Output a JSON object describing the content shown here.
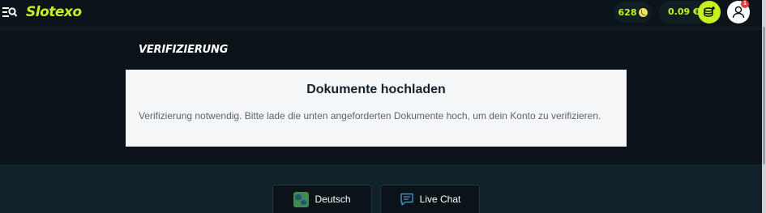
{
  "header": {
    "logo_text": "Slotexo",
    "coins": "628",
    "balance": "0.09 €",
    "notification_count": "1"
  },
  "page": {
    "title": "VERIFIZIERUNG"
  },
  "card": {
    "title": "Dokumente hochladen",
    "text": "Verifizierung notwendig. Bitte lade die unten angeforderten Dokumente hoch, um dein Konto zu verifizieren."
  },
  "footer": {
    "language_label": "Deutsch",
    "chat_label": "Live Chat"
  },
  "colors": {
    "accent": "#c6f31d",
    "background": "#0a1317",
    "card": "#f5f6f8",
    "badge": "#e33a3a"
  },
  "icons": [
    "menu-search-icon",
    "coin-icon",
    "deposit-coins-icon",
    "user-icon",
    "globe-icon",
    "chat-icon"
  ]
}
